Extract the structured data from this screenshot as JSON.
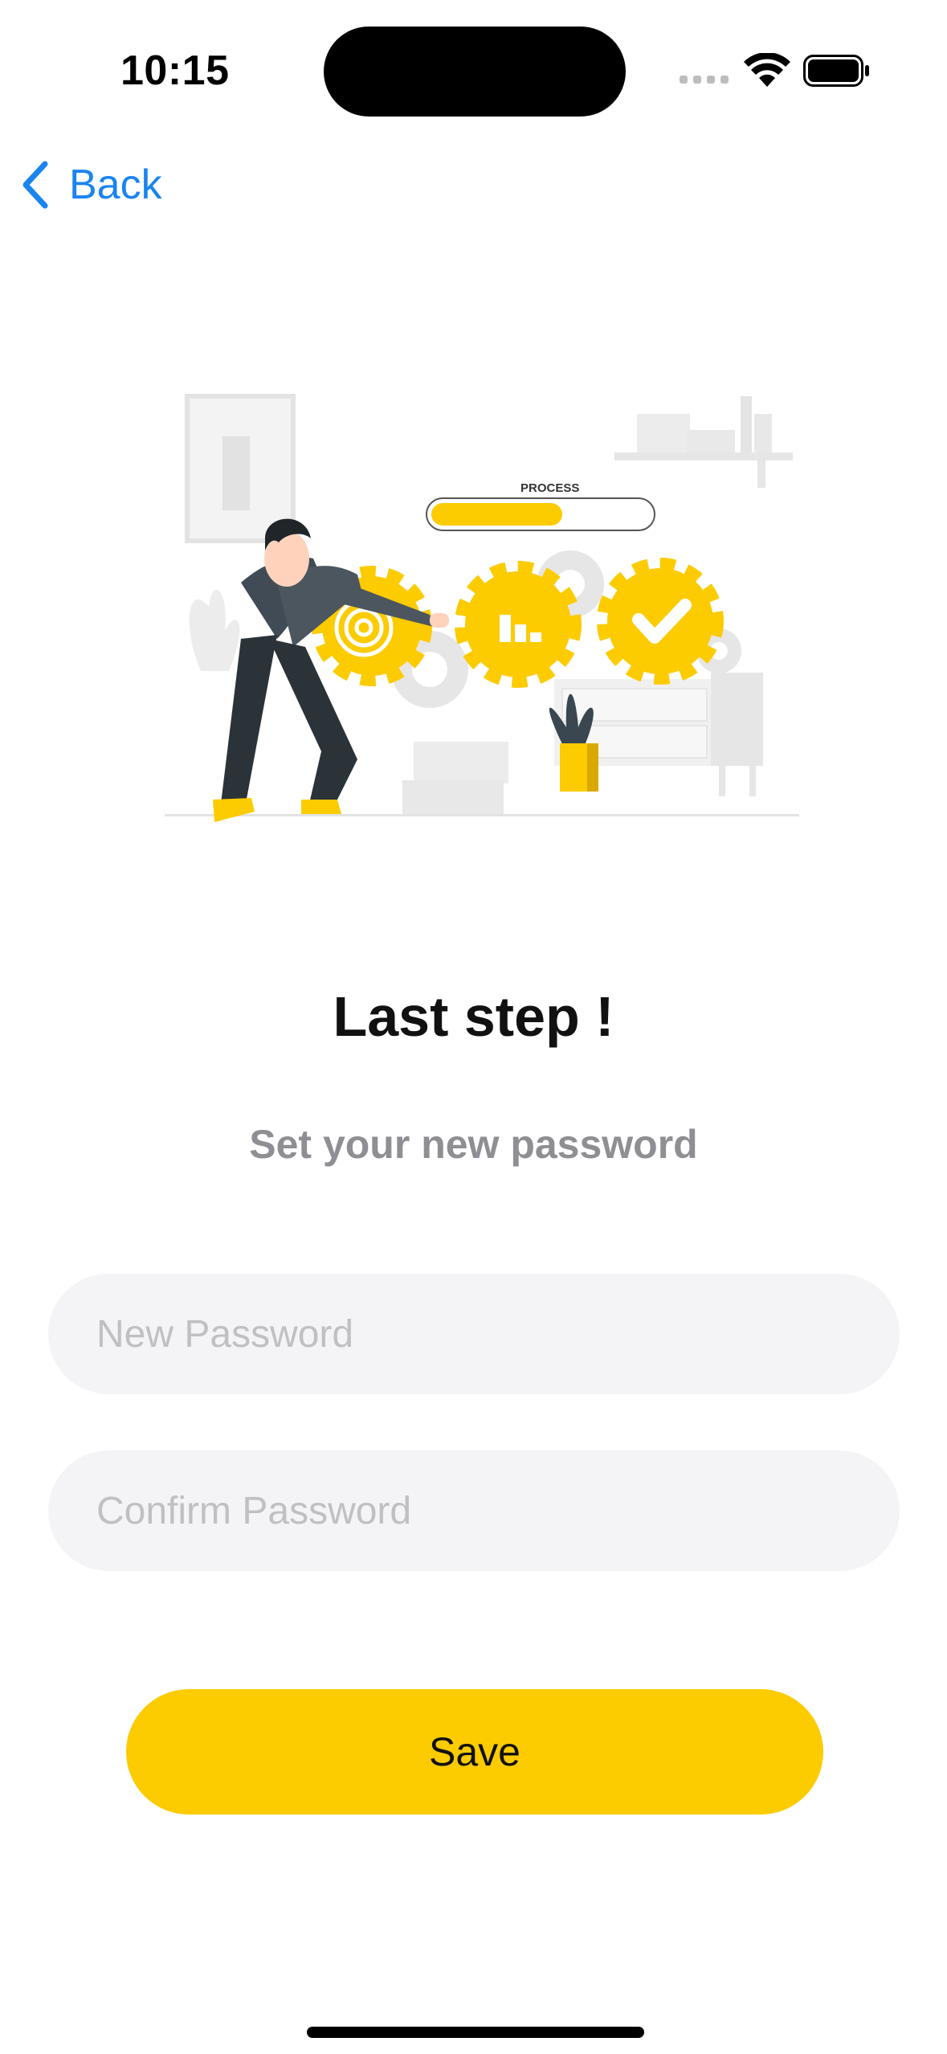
{
  "status_bar": {
    "time": "10:15"
  },
  "nav": {
    "back_label": "Back"
  },
  "illustration": {
    "progress_label": "PROCESS",
    "progress_fraction": 0.6
  },
  "content": {
    "title": "Last step !",
    "subtitle": "Set your new password"
  },
  "form": {
    "new_password_placeholder": "New Password",
    "confirm_password_placeholder": "Confirm Password",
    "save_label": "Save"
  },
  "colors": {
    "accent": "#fccb00",
    "link": "#1a84f0",
    "field_bg": "#f4f4f6",
    "subtitle": "#8e8e93"
  }
}
